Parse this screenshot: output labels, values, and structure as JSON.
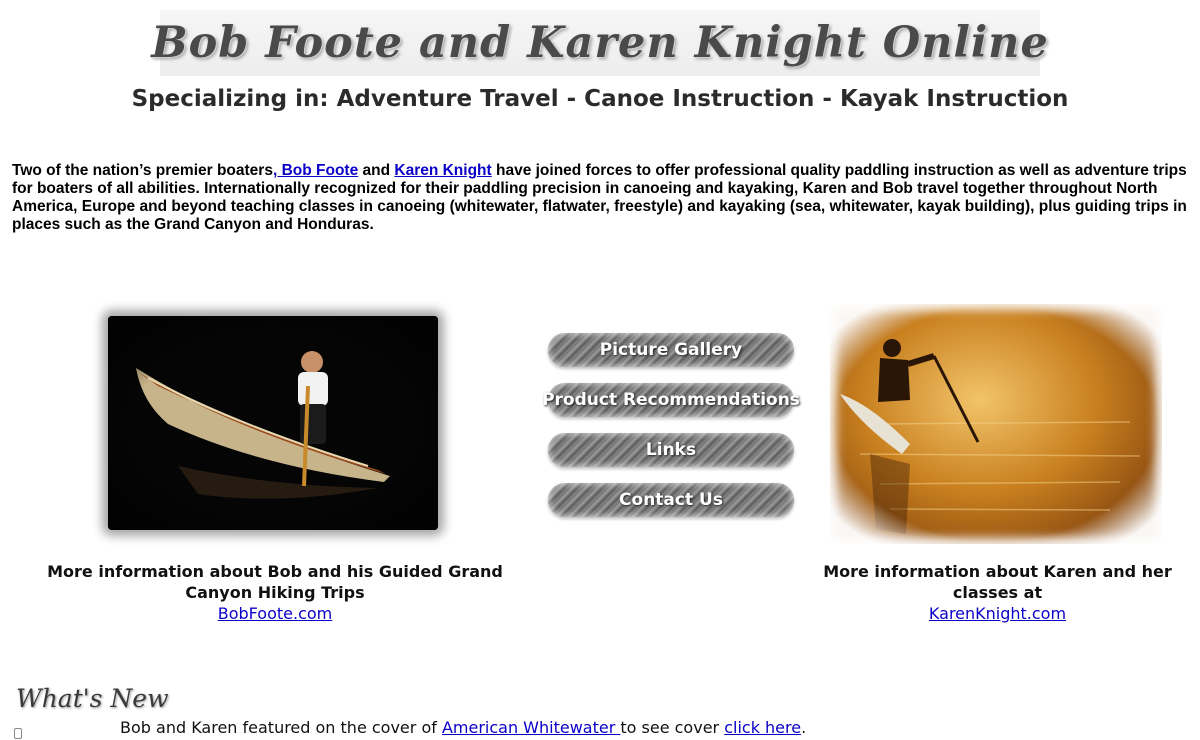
{
  "banner": {
    "title": "Bob Foote and Karen Knight Online"
  },
  "tagline": "Specializing in: Adventure Travel - Canoe Instruction - Kayak Instruction",
  "intro": {
    "text_before": "Two of the nation’s premier boaters",
    "bob_link": ", Bob Foote",
    "and": " and ",
    "karen_link": "Karen Knight",
    "text_after": " have joined forces to offer professional quality paddling instruction as well as adventure trips for boaters of all abilities. Internationally recognized for their paddling precision in canoeing and kayaking, Karen and Bob travel together throughout North America, Europe and beyond teaching classes in canoeing (whitewater, flatwater, freestyle) and  kayaking (sea, whitewater, kayak building), plus guiding trips in places such as the Grand Canyon and Honduras."
  },
  "nav": {
    "picture_gallery": "Picture Gallery",
    "product_recommendations": "Product Recommendations",
    "links": "Links",
    "contact_us": "Contact Us"
  },
  "bob": {
    "caption": "More information about Bob and his Guided Grand Canyon Hiking Trips",
    "link": "BobFoote.com"
  },
  "karen": {
    "caption": "More information about Karen and her classes at",
    "link": "KarenKnight.com"
  },
  "whats_new": {
    "heading": "What's New",
    "text_before": "Bob and Karen featured on the cover of ",
    "aw_link": "American Whitewater ",
    "text_middle": "to see cover ",
    "click_link": "click here",
    "text_after": "."
  }
}
